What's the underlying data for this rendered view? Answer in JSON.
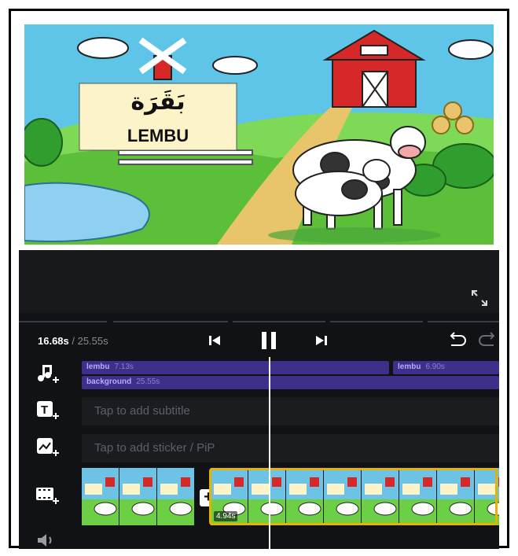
{
  "preview": {
    "sign_arabic": "بَقَرَة",
    "sign_label": "LEMBU"
  },
  "player": {
    "current_time": "16.68s",
    "total_time": " / 25.55s"
  },
  "tracks": {
    "audio": [
      {
        "label": "lembu",
        "duration": "7.13s"
      },
      {
        "label": "lembu",
        "duration": "6.90s"
      },
      {
        "label": "background",
        "duration": "25.55s"
      }
    ],
    "subtitle_placeholder": "Tap to add subtitle",
    "sticker_placeholder": "Tap to add sticker / PiP",
    "selected_clip_duration": "4.94s"
  },
  "icons": {
    "music": "music-add-icon",
    "text": "text-add-icon",
    "sticker": "sticker-add-icon",
    "video": "video-add-icon",
    "volume": "volume-icon",
    "fullscreen": "fullscreen-icon",
    "prev": "skip-previous-icon",
    "pause": "pause-icon",
    "next": "skip-next-icon",
    "undo": "undo-icon",
    "redo": "redo-icon"
  },
  "colors": {
    "accent": "#e6b400",
    "audio_track": "#3d2f8a",
    "sky": "#5fc5e8"
  }
}
